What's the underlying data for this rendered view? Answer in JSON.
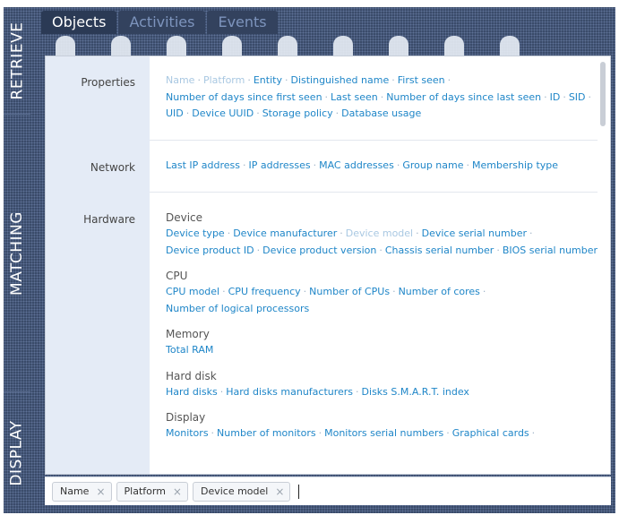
{
  "side_tabs": [
    "RETRIEVE",
    "MATCHING",
    "DISPLAY"
  ],
  "top_tabs": [
    "Objects",
    "Activities",
    "Events"
  ],
  "toolbar_icons": [
    "users-icon",
    "device-icon",
    "layers-icon",
    "globe-icon",
    "gear-icon",
    "package-icon",
    "column-icon",
    "server-icon",
    "world-icon"
  ],
  "sections": {
    "properties": {
      "label": "Properties",
      "lines": [
        [
          {
            "t": "Name",
            "d": true
          },
          {
            "t": "Platform",
            "d": true
          },
          {
            "t": "Entity"
          },
          {
            "t": "Distinguished name"
          },
          {
            "t": "First seen",
            "trail": true
          }
        ],
        [
          {
            "t": "Number of days since first seen"
          },
          {
            "t": "Last seen"
          },
          {
            "t": "Number of days since last seen"
          },
          {
            "t": "ID"
          },
          {
            "t": "SID",
            "trail": true
          }
        ],
        [
          {
            "t": "UID"
          },
          {
            "t": "Device UUID"
          },
          {
            "t": "Storage policy"
          },
          {
            "t": "Database usage"
          }
        ]
      ]
    },
    "network": {
      "label": "Network",
      "lines": [
        [
          {
            "t": "Last IP address"
          },
          {
            "t": "IP addresses"
          },
          {
            "t": "MAC addresses"
          },
          {
            "t": "Group name"
          },
          {
            "t": "Membership type"
          }
        ]
      ]
    },
    "hardware": {
      "label": "Hardware",
      "groups": [
        {
          "title": "Device",
          "lines": [
            [
              {
                "t": "Device type"
              },
              {
                "t": "Device manufacturer"
              },
              {
                "t": "Device model",
                "d": true
              },
              {
                "t": "Device serial number",
                "trail": true
              }
            ],
            [
              {
                "t": "Device product ID"
              },
              {
                "t": "Device product version"
              },
              {
                "t": "Chassis serial number"
              },
              {
                "t": "BIOS serial number"
              }
            ]
          ]
        },
        {
          "title": "CPU",
          "lines": [
            [
              {
                "t": "CPU model"
              },
              {
                "t": "CPU frequency"
              },
              {
                "t": "Number of CPUs"
              },
              {
                "t": "Number of cores",
                "trail": true
              }
            ],
            [
              {
                "t": "Number of logical processors"
              }
            ]
          ]
        },
        {
          "title": "Memory",
          "lines": [
            [
              {
                "t": "Total RAM"
              }
            ]
          ]
        },
        {
          "title": "Hard disk",
          "lines": [
            [
              {
                "t": "Hard disks"
              },
              {
                "t": "Hard disks manufacturers"
              },
              {
                "t": "Disks S.M.A.R.T. index"
              }
            ]
          ]
        },
        {
          "title": "Display",
          "lines": [
            [
              {
                "t": "Monitors"
              },
              {
                "t": "Number of monitors"
              },
              {
                "t": "Monitors serial numbers"
              },
              {
                "t": "Graphical cards",
                "trail": true
              }
            ]
          ]
        }
      ]
    }
  },
  "selected_fields": [
    "Name",
    "Platform",
    "Device model"
  ],
  "chip_remove_glyph": "×",
  "separator_glyph": "·",
  "colors": {
    "link": "#1f86c8",
    "link_disabled": "#a9c8e2",
    "background": "#3a4b6a"
  }
}
